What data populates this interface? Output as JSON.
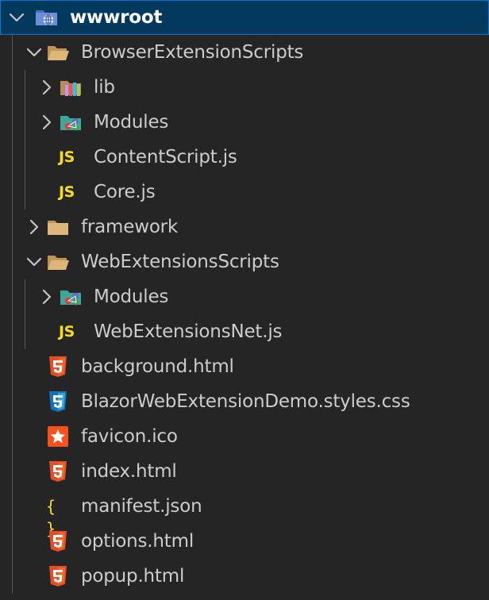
{
  "colors": {
    "background": "#252526",
    "selection": "#04395e",
    "text": "#cccccc",
    "js": "#f5de19",
    "html5": "#e44d26",
    "css3": "#1572b6",
    "folder": "#dcb67a"
  },
  "tree": [
    {
      "name": "wwwroot",
      "depth": 0,
      "kind": "folder",
      "expanded": true,
      "selected": true,
      "icon": "web-folder-icon"
    },
    {
      "name": "BrowserExtensionScripts",
      "depth": 1,
      "kind": "folder",
      "expanded": true,
      "icon": "folder-open-icon"
    },
    {
      "name": "lib",
      "depth": 2,
      "kind": "folder",
      "expanded": false,
      "icon": "library-folder-icon"
    },
    {
      "name": "Modules",
      "depth": 2,
      "kind": "folder",
      "expanded": false,
      "icon": "modules-folder-icon"
    },
    {
      "name": "ContentScript.js",
      "depth": 2,
      "kind": "file",
      "icon": "js-icon"
    },
    {
      "name": "Core.js",
      "depth": 2,
      "kind": "file",
      "icon": "js-icon"
    },
    {
      "name": "framework",
      "depth": 1,
      "kind": "folder",
      "expanded": false,
      "icon": "folder-icon"
    },
    {
      "name": "WebExtensionsScripts",
      "depth": 1,
      "kind": "folder",
      "expanded": true,
      "icon": "folder-open-icon"
    },
    {
      "name": "Modules",
      "depth": 2,
      "kind": "folder",
      "expanded": false,
      "icon": "modules-folder-icon"
    },
    {
      "name": "WebExtensionsNet.js",
      "depth": 2,
      "kind": "file",
      "icon": "js-icon"
    },
    {
      "name": "background.html",
      "depth": 1,
      "kind": "file",
      "icon": "html5-icon"
    },
    {
      "name": "BlazorWebExtensionDemo.styles.css",
      "depth": 1,
      "kind": "file",
      "icon": "css3-icon"
    },
    {
      "name": "favicon.ico",
      "depth": 1,
      "kind": "file",
      "icon": "favicon-icon"
    },
    {
      "name": "index.html",
      "depth": 1,
      "kind": "file",
      "icon": "html5-icon"
    },
    {
      "name": "manifest.json",
      "depth": 1,
      "kind": "file",
      "icon": "json-icon"
    },
    {
      "name": "options.html",
      "depth": 1,
      "kind": "file",
      "icon": "html5-icon"
    },
    {
      "name": "popup.html",
      "depth": 1,
      "kind": "file",
      "icon": "html5-icon"
    }
  ]
}
